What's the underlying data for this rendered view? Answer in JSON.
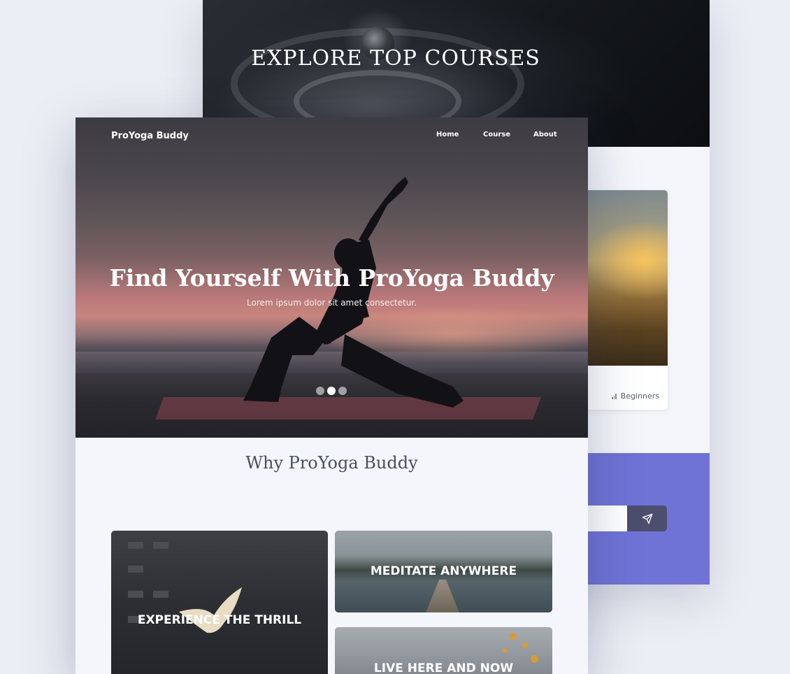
{
  "back_page": {
    "hero_title": "EXPLORE TOP COURSES",
    "course_card": {
      "level": "Beginners",
      "level_icon": "signal-bars-icon"
    },
    "newsletter": {
      "send_icon": "paper-plane-icon"
    }
  },
  "front_page": {
    "nav": {
      "brand": "ProYoga Buddy",
      "links": [
        "Home",
        "Course",
        "About"
      ]
    },
    "hero": {
      "title": "Find Yourself With ProYoga Buddy",
      "subtitle": "Lorem ipsum dolor sit amet consectetur.",
      "carousel_slide_count": 3,
      "carousel_active_slide": 2
    },
    "why": {
      "title": "Why ProYoga Buddy"
    },
    "tiles": [
      "EXPERIENCE THE THRILL",
      "MEDITATE ANYWHERE",
      "LIVE HERE AND NOW"
    ]
  }
}
